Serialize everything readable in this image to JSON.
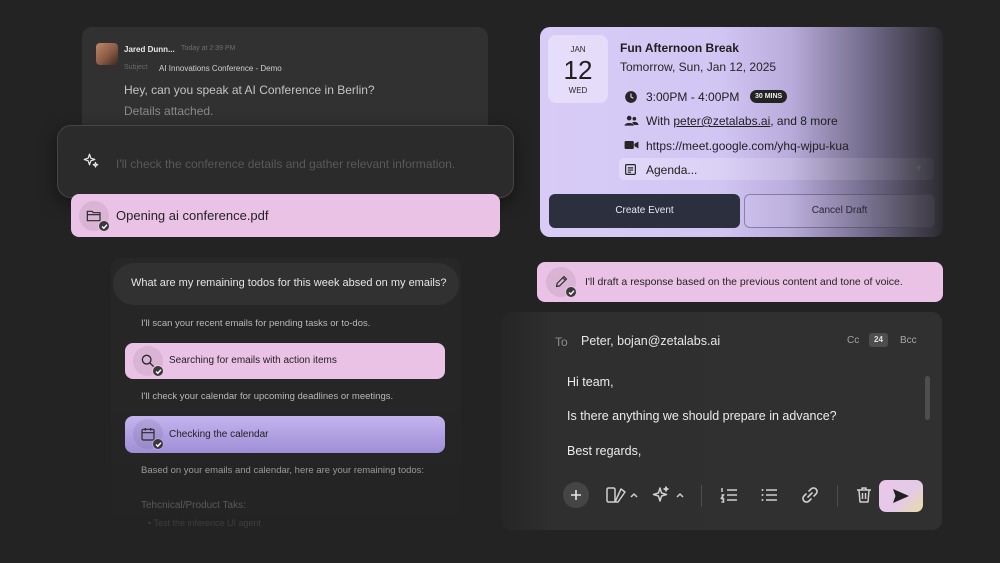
{
  "email": {
    "sender": "Jared Dunn...",
    "time": "Today at 2:39 PM",
    "subject_label": "Subject",
    "subject": "AI Innovations Conference - Demo",
    "line1": "Hey, can you speak at AI Conference in Berlin?",
    "line2": "Details attached."
  },
  "thinking": {
    "text": "I'll check the conference details and gather relevant information."
  },
  "opening": {
    "text": "Opening ai conference.pdf"
  },
  "chat": {
    "user_message": "What are my remaining todos for this week absed on my emails?",
    "ai_line1": "I'll scan your recent emails for pending tasks or to-dos.",
    "search_step": "Searching for emails with action items",
    "ai_line2": "I'll check your calendar for upcoming deadlines or meetings.",
    "calendar_step": "Checking the calendar",
    "ai_line3": "Based on your emails and calendar, here are your remaining todos:",
    "tech_heading": "Tehcnical/Product Taks:",
    "tech_item": "•  Test the inference UI agent"
  },
  "event": {
    "month": "JAN",
    "day": "12",
    "weekday": "WED",
    "title": "Fun Afternoon Break",
    "date": "Tomorrow, Sun, Jan 12, 2025",
    "time": "3:00PM - 4:00PM",
    "duration": "30 MINS",
    "with_prefix": "With ",
    "with_link": "peter@zetalabs.ai",
    "with_suffix": ", and 8 more",
    "meet_link": "https://meet.google.com/yhq-wjpu-kua",
    "agenda": "Agenda...",
    "create_label": "Create Event",
    "cancel_label": "Cancel Draft"
  },
  "draft": {
    "text": "I'll draft a response based on the previous content and tone of voice."
  },
  "compose": {
    "to_label": "To",
    "to_value": "Peter, bojan@zetalabs.ai",
    "cc_label": "Cc",
    "cc_count": "24",
    "bcc_label": "Bcc",
    "body": [
      "Hi team,",
      "Is there anything we should prepare in advance?",
      "Best regards,"
    ]
  },
  "colors": {
    "background": "#232323",
    "pink_pill": "#eac2e6",
    "lavender": "#c3b4ef",
    "card_dark": "#313131"
  }
}
